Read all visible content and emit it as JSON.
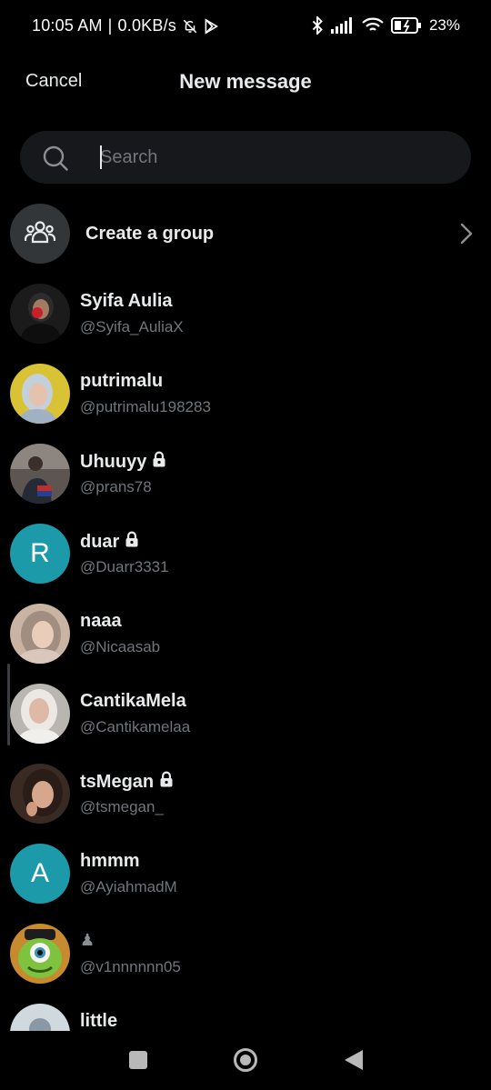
{
  "status_bar": {
    "time": "10:05 AM",
    "separator": "|",
    "network_speed": "0.0KB/s",
    "battery": "23%",
    "icons": [
      "mute-bell-icon",
      "play-store-icon",
      "bluetooth-icon",
      "signal-icon",
      "wifi-icon",
      "battery-icon"
    ]
  },
  "header": {
    "cancel_label": "Cancel",
    "title": "New message"
  },
  "search": {
    "placeholder": "Search",
    "value": ""
  },
  "create_group": {
    "label": "Create a group",
    "icon": "people-group-icon"
  },
  "contacts": [
    {
      "name": "Syifa Aulia",
      "handle": "@Syifa_AuliaX",
      "locked": false,
      "avatar": "photo"
    },
    {
      "name": "putrimalu",
      "handle": "@putrimalu198283",
      "locked": false,
      "avatar": "photo"
    },
    {
      "name": "Uhuuyy",
      "handle": "@prans78",
      "locked": true,
      "avatar": "photo"
    },
    {
      "name": "duar",
      "handle": "@Duarr3331",
      "locked": true,
      "avatar": "letter",
      "letter": "R"
    },
    {
      "name": "naaa",
      "handle": "@Nicaasab",
      "locked": false,
      "avatar": "photo"
    },
    {
      "name": "CantikaMela",
      "handle": "@Cantikamelaa",
      "locked": false,
      "avatar": "photo"
    },
    {
      "name": "tsMegan",
      "handle": "@tsmegan_",
      "locked": true,
      "avatar": "photo"
    },
    {
      "name": "hmmm",
      "handle": "@AyiahmadM",
      "locked": false,
      "avatar": "letter",
      "letter": "A"
    },
    {
      "name": "♟",
      "handle": "@v1nnnnnn05",
      "locked": false,
      "avatar": "photo"
    },
    {
      "name": "little",
      "handle": "",
      "locked": false,
      "avatar": "default"
    }
  ],
  "colors": {
    "background": "#000000",
    "primary_text": "#e7e9ea",
    "secondary_text": "#71767b",
    "search_bg": "#16181c",
    "letter_avatar_bg": "#1d9aaa",
    "group_icon_bg": "#333639"
  },
  "nav_bar": {
    "icons": [
      "recents-square-icon",
      "home-circle-icon",
      "back-triangle-icon"
    ]
  }
}
